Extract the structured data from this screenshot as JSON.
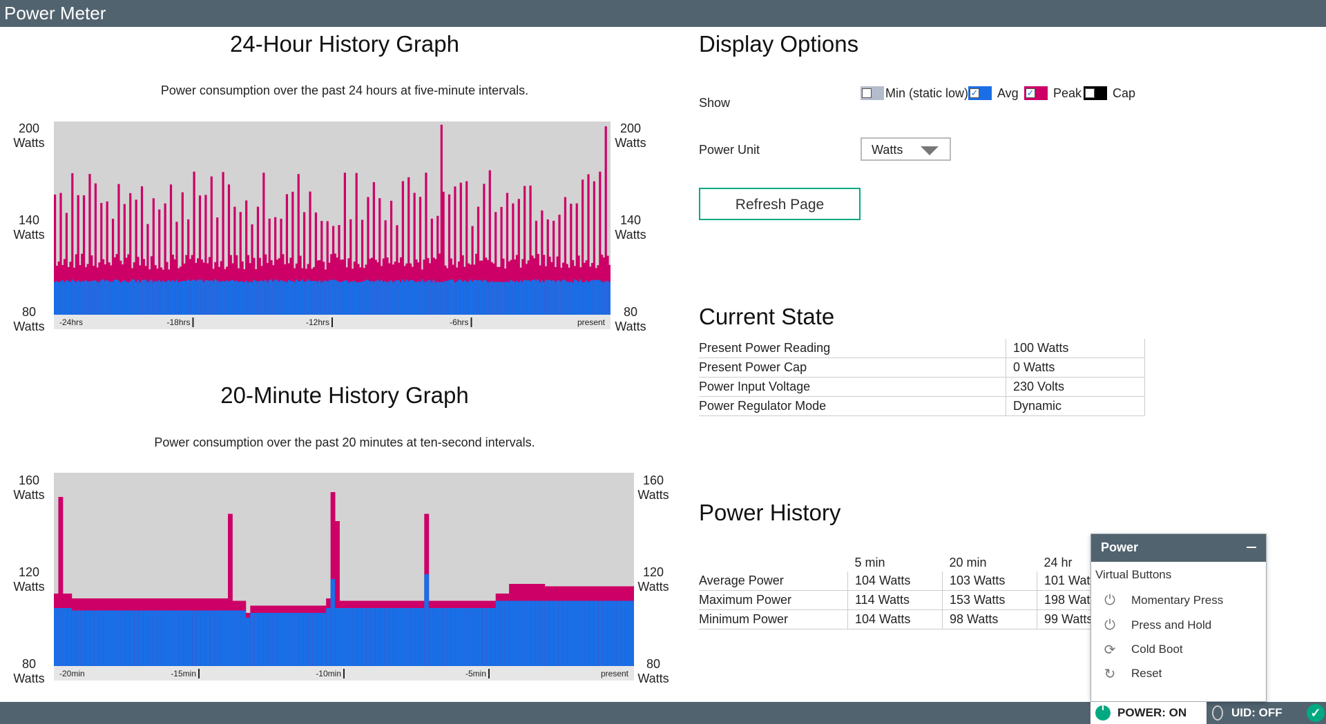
{
  "app": {
    "title": "Power Meter"
  },
  "graph24": {
    "title": "24-Hour History Graph",
    "subtitle": "Power consumption over the past 24 hours at five-minute intervals.",
    "y_top": "200",
    "y_mid": "140",
    "y_bot": "80",
    "unit": "Watts"
  },
  "graph20": {
    "title": "20-Minute History Graph",
    "subtitle": "Power consumption over the past 20 minutes at ten-second intervals.",
    "y_top": "160",
    "y_mid": "120",
    "y_bot": "80",
    "unit": "Watts"
  },
  "chart_data": [
    {
      "type": "bar",
      "stacked": "overlay",
      "ylim": [
        80,
        200
      ],
      "y_ticks": [
        "200 Watts",
        "140 Watts",
        "80 Watts"
      ],
      "x_ticks": [
        "-24hrs",
        "-18hrs",
        "-12hrs",
        "-6hrs",
        "present"
      ],
      "series": [
        {
          "name": "Peak",
          "color": "#cc0066",
          "typical_range": [
            106,
            168
          ],
          "max": 198
        },
        {
          "name": "Avg",
          "color": "#1a6ee6",
          "typical_value": 101
        }
      ],
      "grid": false
    },
    {
      "type": "bar",
      "stacked": "overlay",
      "ylim": [
        80,
        160
      ],
      "y_ticks": [
        "160 Watts",
        "120 Watts",
        "80 Watts"
      ],
      "x_ticks": [
        "-20min",
        "-15min",
        "-10min",
        "-5min",
        "present"
      ],
      "categories_count": 120,
      "series": [
        {
          "name": "Peak",
          "color": "#cc0066",
          "values": [
            110,
            150,
            110,
            110,
            108,
            108,
            108,
            108,
            108,
            108,
            108,
            108,
            108,
            108,
            108,
            108,
            108,
            108,
            108,
            108,
            108,
            108,
            108,
            108,
            108,
            108,
            108,
            108,
            108,
            108,
            108,
            108,
            108,
            108,
            108,
            108,
            108,
            108,
            108,
            143,
            107,
            107,
            107,
            102,
            105,
            105,
            105,
            105,
            105,
            105,
            105,
            105,
            105,
            105,
            105,
            105,
            105,
            105,
            105,
            105,
            105,
            108,
            152,
            140,
            107,
            107,
            107,
            107,
            107,
            107,
            107,
            107,
            107,
            107,
            107,
            107,
            107,
            107,
            107,
            107,
            107,
            107,
            107,
            143,
            107,
            107,
            107,
            107,
            107,
            107,
            107,
            107,
            107,
            107,
            107,
            107,
            107,
            107,
            107,
            110,
            110,
            110,
            114,
            114,
            114,
            114,
            114,
            114,
            114,
            114,
            113,
            113,
            113,
            113,
            113,
            113,
            113,
            113,
            113,
            113,
            113,
            113,
            113,
            113,
            113,
            113,
            113,
            113,
            113,
            113
          ]
        },
        {
          "name": "Avg",
          "color": "#1a6ee6",
          "values": [
            104,
            104,
            104,
            104,
            103,
            103,
            103,
            103,
            103,
            103,
            103,
            103,
            103,
            103,
            103,
            103,
            103,
            103,
            103,
            103,
            103,
            103,
            103,
            103,
            103,
            103,
            103,
            103,
            103,
            103,
            103,
            103,
            103,
            103,
            103,
            103,
            103,
            103,
            103,
            103,
            103,
            103,
            103,
            100,
            102,
            102,
            102,
            102,
            102,
            102,
            102,
            102,
            102,
            102,
            102,
            102,
            102,
            102,
            102,
            102,
            102,
            104,
            116,
            104,
            104,
            104,
            104,
            104,
            104,
            104,
            104,
            104,
            104,
            104,
            104,
            104,
            104,
            104,
            104,
            104,
            104,
            104,
            104,
            118,
            104,
            104,
            104,
            104,
            104,
            104,
            104,
            104,
            104,
            104,
            104,
            104,
            104,
            104,
            104,
            107,
            107,
            107,
            107,
            107,
            107,
            107,
            107,
            107,
            107,
            107,
            107,
            107,
            107,
            107,
            107,
            107,
            107,
            107,
            107,
            107,
            107,
            107,
            107,
            107,
            107,
            107,
            107,
            107,
            107,
            107
          ]
        }
      ],
      "grid": false
    }
  ],
  "display": {
    "title": "Display Options",
    "show_label": "Show",
    "checks": [
      {
        "label": "Min (static low)",
        "color": "#b3bccb",
        "checked": false
      },
      {
        "label": "Avg",
        "color": "#1a6ee6",
        "checked": true
      },
      {
        "label": "Peak",
        "color": "#cc0066",
        "checked": true
      },
      {
        "label": "Cap",
        "color": "#000000",
        "checked": false
      }
    ],
    "unit_label": "Power Unit",
    "unit_value": "Watts",
    "refresh": "Refresh Page"
  },
  "state": {
    "title": "Current State",
    "rows": [
      {
        "k": "Present Power Reading",
        "v": "100 Watts"
      },
      {
        "k": "Present Power Cap",
        "v": "0 Watts"
      },
      {
        "k": "Power Input Voltage",
        "v": "230 Volts"
      },
      {
        "k": "Power Regulator Mode",
        "v": "Dynamic"
      }
    ]
  },
  "history": {
    "title": "Power History",
    "cols": [
      "5 min",
      "20 min",
      "24 hr"
    ],
    "rows": [
      {
        "k": "Average Power",
        "a": "104 Watts",
        "b": "103 Watts",
        "c": "101 Watts"
      },
      {
        "k": "Maximum Power",
        "a": "114 Watts",
        "b": "153 Watts",
        "c": "198 Watts"
      },
      {
        "k": "Minimum Power",
        "a": "104 Watts",
        "b": "98 Watts",
        "c": "99 Watts"
      }
    ]
  },
  "popup": {
    "title": "Power",
    "section": "Virtual Buttons",
    "items": [
      {
        "label": "Momentary Press",
        "icon": "power-icon"
      },
      {
        "label": "Press and Hold",
        "icon": "power-hold-icon"
      },
      {
        "label": "Cold Boot",
        "icon": "cold-boot-icon"
      },
      {
        "label": "Reset",
        "icon": "reset-icon"
      }
    ]
  },
  "statusbar": {
    "power": "POWER: ON",
    "uid": "UID: OFF"
  }
}
